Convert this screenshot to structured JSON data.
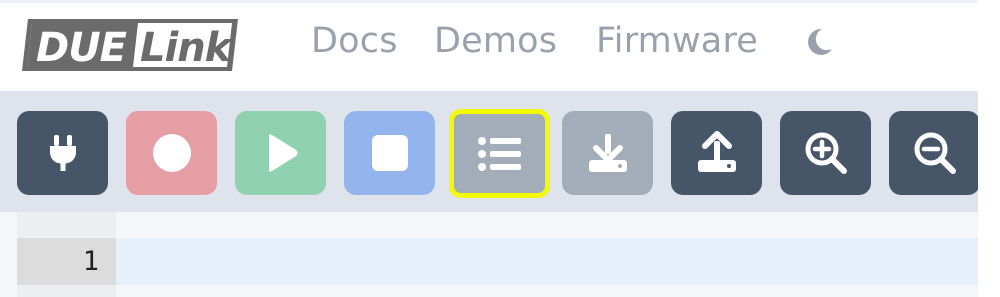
{
  "navbar": {
    "logo_alt": "DUELink",
    "links": [
      {
        "label": "Docs"
      },
      {
        "label": "Demos"
      },
      {
        "label": "Firmware"
      }
    ],
    "theme_toggle_icon": "moon-icon"
  },
  "toolbar": {
    "buttons": [
      {
        "name": "connect-button",
        "icon": "plug-icon",
        "color": "#475569",
        "enabled": true
      },
      {
        "name": "record-button",
        "icon": "record-icon",
        "color": "#e59ea3",
        "enabled": false
      },
      {
        "name": "run-button",
        "icon": "play-icon",
        "color": "#8fd1b0",
        "enabled": false
      },
      {
        "name": "stop-button",
        "icon": "stop-icon",
        "color": "#93b4ec",
        "enabled": false
      },
      {
        "name": "list-button",
        "icon": "list-icon",
        "color": "#a3acb9",
        "enabled": false,
        "highlighted": true
      },
      {
        "name": "download-button",
        "icon": "download-icon",
        "color": "#a3acb9",
        "enabled": false
      },
      {
        "name": "upload-button",
        "icon": "upload-icon",
        "color": "#475569",
        "enabled": true
      },
      {
        "name": "zoom-in-button",
        "icon": "zoom-in-icon",
        "color": "#475569",
        "enabled": true
      },
      {
        "name": "zoom-out-button",
        "icon": "zoom-out-icon",
        "color": "#475569",
        "enabled": true
      }
    ],
    "highlight_color": "#f2fb00"
  },
  "editor": {
    "lines": [
      {
        "number": "1",
        "text": ""
      }
    ]
  }
}
